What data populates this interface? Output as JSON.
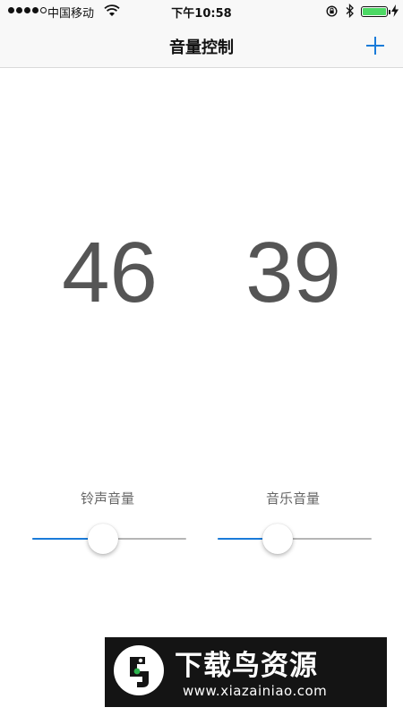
{
  "status_bar": {
    "carrier": "中国移动",
    "time": "下午10:58"
  },
  "icons": {
    "signal": "signal-dots-icon",
    "wifi": "wifi-icon",
    "orientation_lock": "orientation-lock-icon",
    "bluetooth": "bluetooth-icon",
    "battery": "battery-icon",
    "charging": "charging-bolt-icon",
    "add": "plus-icon"
  },
  "colors": {
    "accent": "#1a7bd9",
    "battery": "#4cd964",
    "value_text": "#555555"
  },
  "nav": {
    "title": "音量控制"
  },
  "controls": {
    "ringtone": {
      "value": "46",
      "label": "铃声音量",
      "level": 0.46
    },
    "music": {
      "value": "39",
      "label": "音乐音量",
      "level": 0.39
    }
  },
  "watermark": {
    "title": "下载鸟资源",
    "url": "www.xiazainiao.com"
  }
}
